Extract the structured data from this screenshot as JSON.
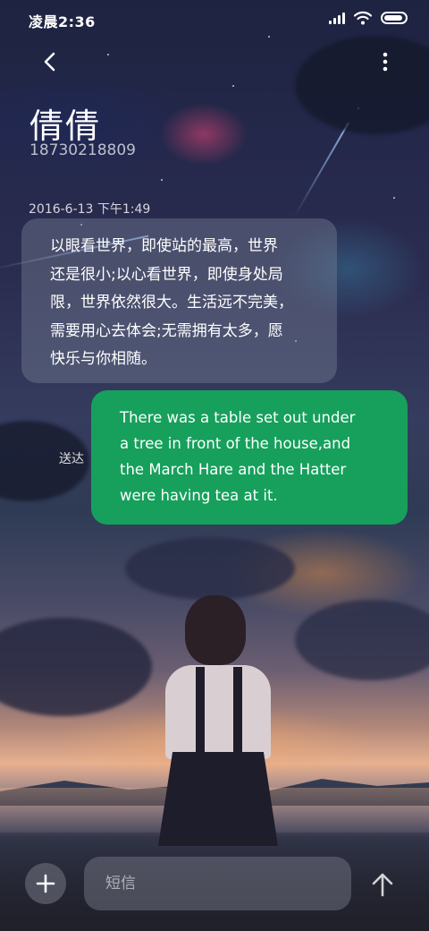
{
  "status_bar": {
    "time": "凌晨2:36",
    "icons": [
      "signal-icon",
      "wifi-icon",
      "battery-icon"
    ]
  },
  "header": {
    "back_icon": "chevron-left-icon",
    "more_icon": "more-vertical-icon",
    "contact_name": "倩倩",
    "contact_number": "18730218809"
  },
  "conversation": {
    "timestamp": "2016-6-13 下午1:49",
    "incoming": {
      "lines": [
        "以眼看世界，即使站的最高，世界",
        "还是很小;以心看世界，即使身处局",
        "限，世界依然很大。生活远不完美，",
        "需要用心去体会;无需拥有太多，愿",
        "快乐与你相随。"
      ]
    },
    "outgoing": {
      "status": "送达",
      "lines": [
        "There was a table set out under",
        "a tree in front of the house,and",
        "the March Hare and the Hatter",
        "were having tea at it."
      ],
      "color": "#16a05c"
    }
  },
  "composer": {
    "add_icon": "plus-icon",
    "placeholder": "短信",
    "value": "",
    "send_icon": "arrow-up-icon"
  }
}
